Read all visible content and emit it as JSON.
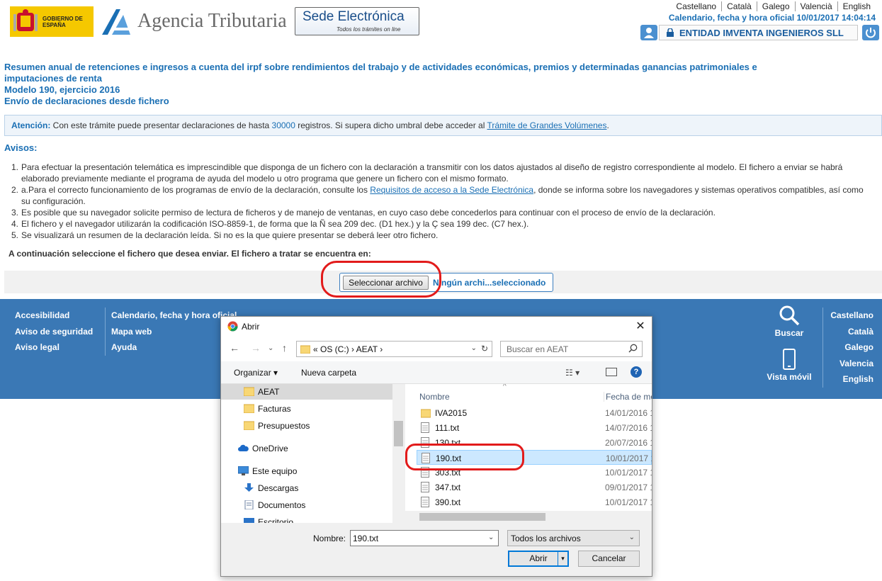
{
  "header": {
    "gov_logo_text": "GOBIERNO DE ESPAÑA",
    "agency_name": "Agencia Tributaria",
    "sede_title": "Sede Electrónica",
    "sede_subtitle": "Todos los trámites on line",
    "languages": [
      "Castellano",
      "Català",
      "Galego",
      "Valencià",
      "English"
    ],
    "datetime": "Calendario, fecha y hora oficial 10/01/2017 14:04:14",
    "entity": "ENTIDAD IMVENTA INGENIEROS SLL"
  },
  "page": {
    "title_lines": [
      "Resumen anual de retenciones e ingresos a cuenta del irpf sobre rendimientos del trabajo y de actividades económicas, premios y determinadas ganancias patrimoniales e",
      "imputaciones de renta",
      "Modelo 190, ejercicio 2016",
      "Envío de declaraciones desde fichero"
    ],
    "notice": {
      "label": "Atención:",
      "text_a": " Con este trámite puede presentar declaraciones de hasta ",
      "number": "30000",
      "text_b": " registros. Si supera dicho umbral debe acceder al ",
      "link": "Trámite de Grandes Volúmenes",
      "text_c": "."
    },
    "avisos_title": "Avisos:",
    "avisos": [
      {
        "n": "1.",
        "lines": [
          "Para efectuar la presentación telemática es imprescindible que disponga de un fichero con la declaración a transmitir con los datos ajustados al diseño de registro correspondiente al modelo. El fichero a enviar se habrá",
          "elaborado previamente mediante el programa de ayuda del modelo u otro programa que genere un fichero con el mismo formato."
        ]
      },
      {
        "n": "2.",
        "pre": "a.Para el correcto funcionamiento de los programas de envío de la declaración, consulte los ",
        "link": "Requisitos de acceso a la Sede Electrónica",
        "post": ", donde se informa sobre los navegadores y sistemas operativos compatibles, así como",
        "line2": "su configuración."
      },
      {
        "n": "3.",
        "lines": [
          "Es posible que su navegador solicite permiso de lectura de ficheros y de manejo de ventanas, en cuyo caso debe concederlos para continuar con el proceso de envío de la declaración."
        ]
      },
      {
        "n": "4.",
        "lines": [
          "El fichero y el navegador utilizarán la codificación ISO-8859-1, de forma que la Ñ sea 209 dec. (D1 hex.) y la Ç sea 199 dec. (C7 hex.)."
        ]
      },
      {
        "n": "5.",
        "lines": [
          "Se visualizará un resumen de la declaración leída. Si no es la que quiere presentar se deberá leer otro fichero."
        ]
      }
    ],
    "select_label": "A continuación seleccione el fichero que desea enviar. El fichero a tratar se encuentra en:",
    "file_button": "Seleccionar archivo",
    "file_none": "Ningún archi...seleccionado"
  },
  "footer": {
    "col1": [
      "Accesibilidad",
      "Aviso de seguridad",
      "Aviso legal"
    ],
    "col2": [
      "Calendario, fecha y hora oficial",
      "Mapa web",
      "Ayuda"
    ],
    "search": "Buscar",
    "mobile": "Vista móvil",
    "languages": [
      "Castellano",
      "Català",
      "Galego",
      "Valencia",
      "English"
    ]
  },
  "dialog": {
    "title": "Abrir",
    "address": "«  OS (C:)  ›  AEAT  ›",
    "search_placeholder": "Buscar en AEAT",
    "organize": "Organizar ▾",
    "new_folder": "Nueva carpeta",
    "nav_items": [
      "AEAT",
      "Facturas",
      "Presupuestos",
      "OneDrive",
      "Este equipo",
      "Descargas",
      "Documentos",
      "Escritorio"
    ],
    "col_name": "Nombre",
    "col_date": "Fecha de mo",
    "files": [
      {
        "name": "IVA2015",
        "date": "14/01/2016 1",
        "type": "folder"
      },
      {
        "name": "111.txt",
        "date": "14/07/2016 1",
        "type": "file"
      },
      {
        "name": "130.txt",
        "date": "20/07/2016 1",
        "type": "file"
      },
      {
        "name": "190.txt",
        "date": "10/01/2017 14",
        "type": "file"
      },
      {
        "name": "303.txt",
        "date": "10/01/2017 1",
        "type": "file"
      },
      {
        "name": "347.txt",
        "date": "09/01/2017 1",
        "type": "file"
      },
      {
        "name": "390.txt",
        "date": "10/01/2017 1",
        "type": "file"
      }
    ],
    "filename_label": "Nombre:",
    "filename_value": "190.txt",
    "filetype": "Todos los archivos",
    "open": "Abrir",
    "cancel": "Cancelar"
  }
}
